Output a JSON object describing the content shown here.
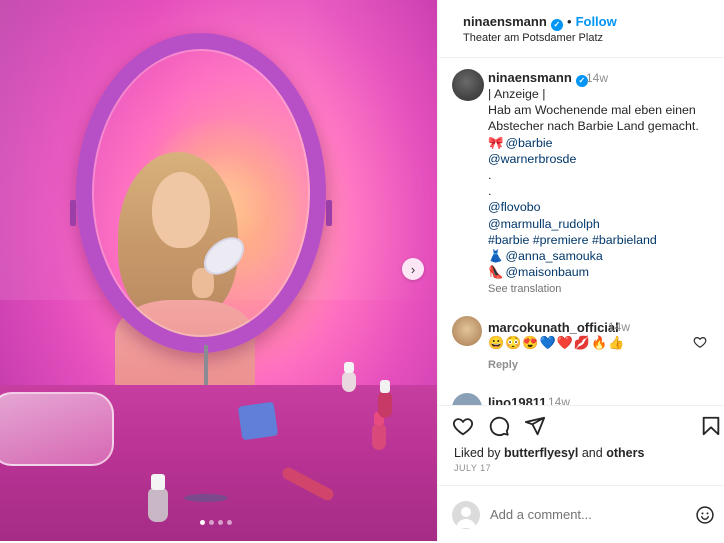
{
  "post": {
    "header": {
      "username": "ninaensmann",
      "separator": "•",
      "follow_label": "Follow",
      "location": "Theater am Potsdamer Platz"
    },
    "caption": {
      "username": "ninaensmann",
      "time": "14w",
      "lines": [
        {
          "text": "| Anzeige |"
        },
        {
          "text": "Hab am Wochenende mal eben einen"
        },
        {
          "text": "Abstecher nach Barbie Land gemacht."
        },
        {
          "emoji": "🎀",
          "text": "@barbie"
        },
        {
          "text": "@warnerbrosde"
        },
        {
          "text": "."
        },
        {
          "text": "."
        },
        {
          "text": "@flovobo"
        },
        {
          "text": "@marmulla_rudolph"
        },
        {
          "text": "#barbie #premiere #barbieland"
        },
        {
          "emoji": "👗",
          "text": "@anna_samouka"
        },
        {
          "emoji": "👠",
          "text": "@maisonbaum"
        }
      ],
      "see_translation": "See translation"
    },
    "comments": [
      {
        "username": "marcokunath_official",
        "time": "14w",
        "text": "😀😳😍💙❤️💋🔥👍",
        "reply_label": "Reply"
      },
      {
        "username": "lino19811",
        "time": "14w"
      }
    ],
    "likes": {
      "prefix": "Liked by ",
      "user": "butterflyesyl",
      "middle": " and ",
      "others": "others"
    },
    "date": "JULY 17",
    "add_comment": {
      "placeholder": "Add a comment..."
    },
    "carousel": {
      "current": 1,
      "total": 4
    }
  },
  "icons": {
    "verified": "verified-badge-icon",
    "next": "chevron-right-icon",
    "like": "heart-icon",
    "comment": "comment-icon",
    "share": "send-icon",
    "save": "bookmark-icon",
    "emoji": "smiley-icon"
  },
  "colors": {
    "link": "#0095f6",
    "mention": "#00376b",
    "muted": "#8e8e8e",
    "text": "#262626"
  }
}
